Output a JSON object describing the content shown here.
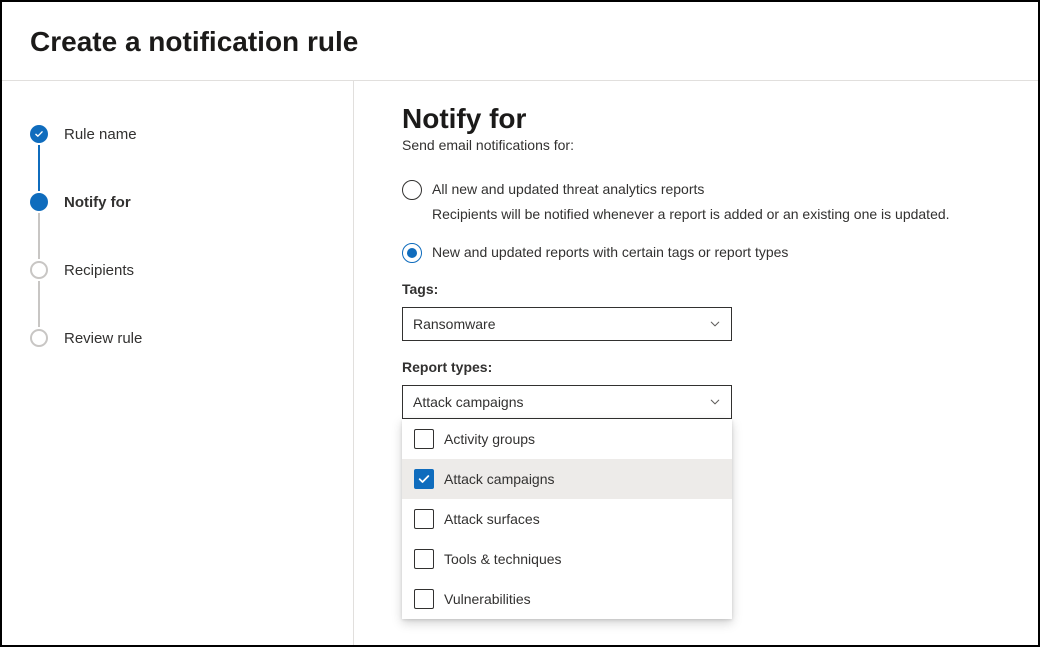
{
  "header": {
    "title": "Create a notification rule"
  },
  "stepper": {
    "steps": [
      {
        "label": "Rule name",
        "state": "done"
      },
      {
        "label": "Notify for",
        "state": "current"
      },
      {
        "label": "Recipients",
        "state": "pending"
      },
      {
        "label": "Review rule",
        "state": "pending"
      }
    ]
  },
  "main": {
    "heading": "Notify for",
    "subtitle": "Send email notifications for:",
    "radios": [
      {
        "label": "All new and updated threat analytics reports",
        "desc": "Recipients will be notified whenever a report is added or an existing one is updated.",
        "selected": false
      },
      {
        "label": "New and updated reports with certain tags or report types",
        "desc": "",
        "selected": true
      }
    ],
    "tags_label": "Tags:",
    "tags_value": "Ransomware",
    "report_types_label": "Report types:",
    "report_types_value": "Attack campaigns",
    "report_type_options": [
      {
        "label": "Activity groups",
        "checked": false
      },
      {
        "label": "Attack campaigns",
        "checked": true
      },
      {
        "label": "Attack surfaces",
        "checked": false
      },
      {
        "label": "Tools & techniques",
        "checked": false
      },
      {
        "label": "Vulnerabilities",
        "checked": false
      }
    ]
  }
}
